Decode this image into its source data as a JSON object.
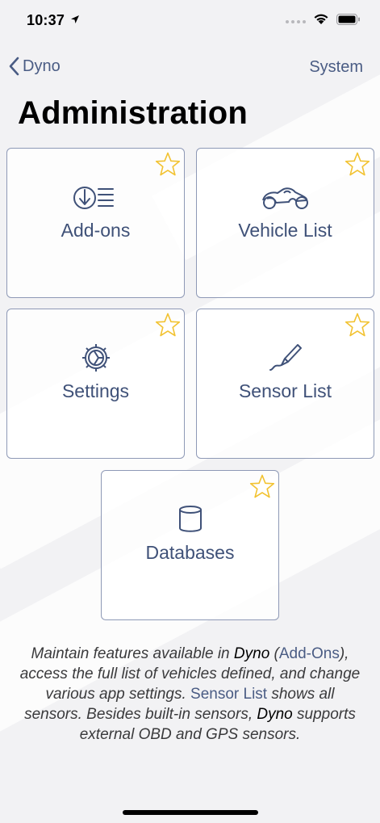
{
  "status_bar": {
    "time": "10:37"
  },
  "nav": {
    "back_label": "Dyno",
    "right_label": "System"
  },
  "title": "Administration",
  "tiles": [
    {
      "label": "Add-ons",
      "icon": "download-list-icon"
    },
    {
      "label": "Vehicle List",
      "icon": "motorcycle-icon"
    },
    {
      "label": "Settings",
      "icon": "gear-icon"
    },
    {
      "label": "Sensor List",
      "icon": "sensor-wand-icon"
    },
    {
      "label": "Databases",
      "icon": "database-icon"
    }
  ],
  "description": {
    "p1": "Maintain features available in ",
    "brand1": "Dyno",
    "p2": " (",
    "link1": "Add-Ons",
    "p3": "), access the full list of vehicles defined, and change various app settings. ",
    "link2": "Sensor List",
    "p4": " shows all sensors. Besides built-in sensors, ",
    "brand2": "Dyno",
    "p5": " supports external OBD and GPS sensors."
  },
  "colors": {
    "accent": "#4a5c84",
    "tile_border": "#8e99b6",
    "star": "#f2c230",
    "text_label": "#3f5178"
  }
}
